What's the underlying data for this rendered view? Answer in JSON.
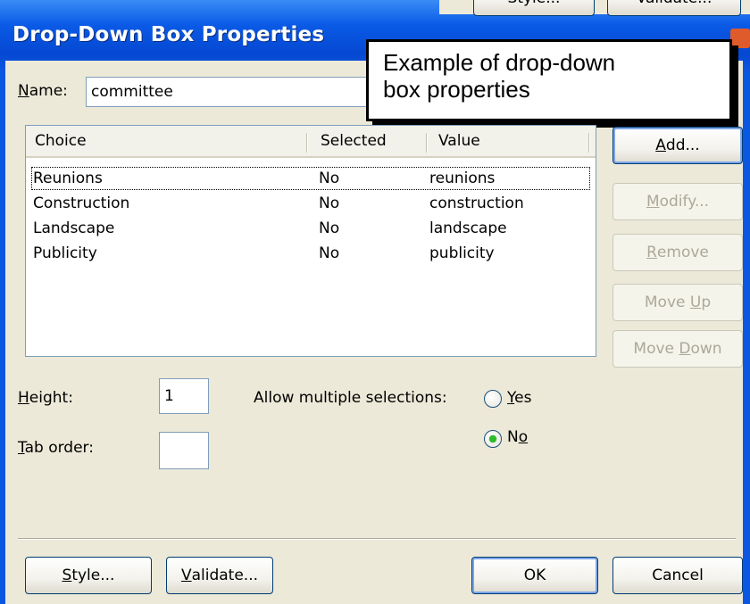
{
  "window": {
    "title": "Drop-Down Box Properties"
  },
  "background_buttons": {
    "style_label": "Style...",
    "validate_label": "Validate..."
  },
  "callout": {
    "line1": "Example of drop-down",
    "line2": "box properties"
  },
  "name_field": {
    "label_u": "N",
    "label_rest": "ame:",
    "value": "committee"
  },
  "choices_table": {
    "columns": [
      "Choice",
      "Selected",
      "Value"
    ],
    "rows": [
      {
        "choice": "Reunions",
        "selected": "No",
        "value": "reunions"
      },
      {
        "choice": "Construction",
        "selected": "No",
        "value": "construction"
      },
      {
        "choice": "Landscape",
        "selected": "No",
        "value": "landscape"
      },
      {
        "choice": "Publicity",
        "selected": "No",
        "value": "publicity"
      }
    ]
  },
  "side_buttons": {
    "add": {
      "u": "A",
      "rest": "dd..."
    },
    "modify": {
      "u": "M",
      "rest": "odify..."
    },
    "remove": {
      "u": "R",
      "rest": "emove"
    },
    "move_up": {
      "pre": "Move ",
      "u": "U",
      "rest": "p"
    },
    "move_down": {
      "pre": "Move ",
      "u": "D",
      "rest": "own"
    }
  },
  "height_field": {
    "label_u": "H",
    "label_rest": "eight:",
    "value": "1"
  },
  "tab_order_field": {
    "label_u": "T",
    "label_rest": "ab order:",
    "value": ""
  },
  "multiple_selection": {
    "label": "Allow multiple selections:",
    "yes": {
      "u": "Y",
      "rest": "es",
      "checked": false
    },
    "no": {
      "pre": "N",
      "u": "o",
      "checked": true
    }
  },
  "bottom_buttons": {
    "style": {
      "u": "S",
      "rest": "tyle..."
    },
    "validate": {
      "u": "V",
      "rest": "alidate..."
    },
    "ok": "OK",
    "cancel": "Cancel"
  },
  "colors": {
    "titlebar": "#0a5ae6",
    "dialog_face": "#ece9d8",
    "radio_dot": "#2bbd2b"
  }
}
